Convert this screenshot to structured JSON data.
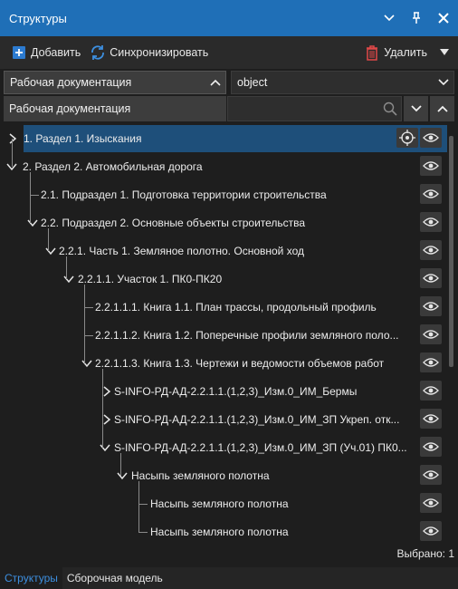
{
  "window": {
    "title": "Структуры"
  },
  "toolbar": {
    "add_label": "Добавить",
    "sync_label": "Синхронизировать",
    "delete_label": "Удалить"
  },
  "selectors": {
    "documentation_value": "Рабочая документация",
    "object_value": "object",
    "filter_label": "Рабочая документация",
    "search_placeholder": ""
  },
  "tree": {
    "nodes": [
      {
        "label": "1. Раздел 1. Изыскания",
        "selected": true
      },
      {
        "label": "2. Раздел 2. Автомобильная дорога"
      },
      {
        "label": "2.1. Подраздел 1. Подготовка территории строительства"
      },
      {
        "label": "2.2. Подраздел 2. Основные объекты строительства"
      },
      {
        "label": "2.2.1. Часть 1. Земляное полотно. Основной ход"
      },
      {
        "label": "2.2.1.1. Участок 1. ПК0-ПК20"
      },
      {
        "label": "2.2.1.1.1. Книга 1.1. План трассы, продольный профиль"
      },
      {
        "label": "2.2.1.1.2. Книга 1.2. Поперечные профили земляного поло..."
      },
      {
        "label": "2.2.1.1.3. Книга 1.3. Чертежи и ведомости объемов работ"
      },
      {
        "label": "S-INFO-РД-АД-2.2.1.1.(1,2,3)_Изм.0_ИМ_Бермы"
      },
      {
        "label": "S-INFO-РД-АД-2.2.1.1.(1,2,3)_Изм.0_ИМ_ЗП Укреп. отк..."
      },
      {
        "label": "S-INFO-РД-АД-2.2.1.1.(1,2,3)_Изм.0_ИМ_ЗП (Уч.01) ПК0..."
      },
      {
        "label": "Насыпь земляного полотна"
      },
      {
        "label": "Насыпь земляного полотна"
      },
      {
        "label": "Насыпь земляного полотна"
      }
    ]
  },
  "status": {
    "selected": "Выбрано: 1"
  },
  "tabs": [
    {
      "label": "Структуры",
      "active": true
    },
    {
      "label": "Сборочная модель",
      "active": false
    }
  ],
  "colors": {
    "accent": "#1f6fb7",
    "selection": "#1e4f7a",
    "delete_red": "#e04848"
  },
  "icons": [
    "chevron-down-icon",
    "pin-icon",
    "close-icon",
    "add-icon",
    "sync-icon",
    "trash-icon",
    "search-icon",
    "eye-icon",
    "target-icon"
  ]
}
